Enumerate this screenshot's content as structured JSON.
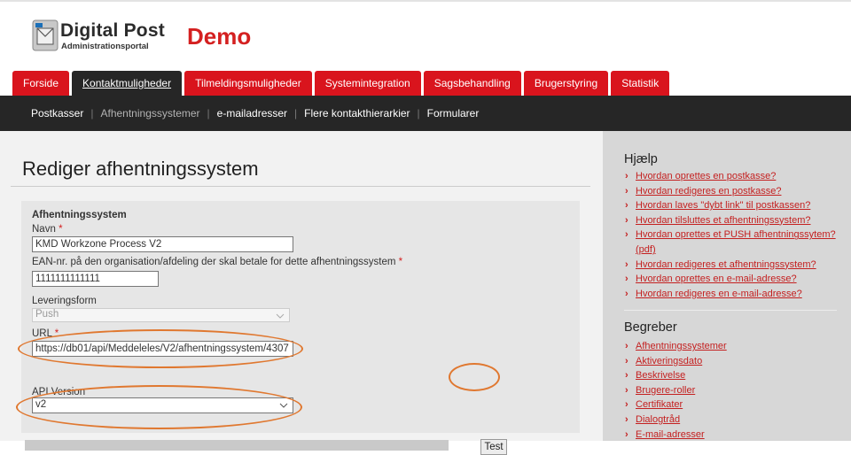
{
  "header": {
    "logo_title": "Digital Post",
    "logo_subtitle": "Administrationsportal",
    "demo_label": "Demo"
  },
  "tabs": [
    {
      "label": "Forside",
      "active": false
    },
    {
      "label": "Kontaktmuligheder",
      "active": true
    },
    {
      "label": "Tilmeldingsmuligheder",
      "active": false
    },
    {
      "label": "Systemintegration",
      "active": false
    },
    {
      "label": "Sagsbehandling",
      "active": false
    },
    {
      "label": "Brugerstyring",
      "active": false
    },
    {
      "label": "Statistik",
      "active": false
    }
  ],
  "subnav": [
    {
      "label": "Postkasser",
      "active": false
    },
    {
      "label": "Afhentningssystemer",
      "active": true
    },
    {
      "label": "e-mailadresser",
      "active": false
    },
    {
      "label": "Flere kontakthierarkier",
      "active": false
    },
    {
      "label": "Formularer",
      "active": false
    }
  ],
  "page": {
    "title": "Rediger afhentningssystem"
  },
  "form": {
    "section_title": "Afhentningssystem",
    "name_label": "Navn",
    "name_value": "KMD Workzone Process V2",
    "ean_label": "EAN-nr. på den organisation/afdeling der skal betale for dette afhentningssystem",
    "ean_value": "1111111111111",
    "delivery_label": "Leveringsform",
    "delivery_value": "Push",
    "url_label": "URL",
    "url_value": "https://db01/api/Meddeleles/V2/afhentningssystem/4307",
    "test_label": "Test",
    "api_label": "API Version",
    "api_value": "v2",
    "required_mark": "*"
  },
  "help": {
    "title": "Hjælp",
    "links": [
      "Hvordan oprettes en postkasse?",
      "Hvordan redigeres en postkasse?",
      "Hvordan laves \"dybt link\" til postkassen?",
      "Hvordan tilsluttes et afhentningssystem?",
      "Hvordan oprettes et PUSH afhentningssytem? (pdf)",
      "Hvordan redigeres et afhentningssystem?",
      "Hvordan oprettes en e-mail-adresse?",
      "Hvordan redigeres en e-mail-adresse?"
    ]
  },
  "concepts": {
    "title": "Begreber",
    "links": [
      "Afhentningssystemer",
      "Aktiveringsdato",
      "Beskrivelse",
      "Brugere-roller",
      "Certifikater",
      "Dialogtråd",
      "E-mail-adresser"
    ]
  },
  "colors": {
    "brand_red": "#d9141d",
    "nav_dark": "#262626",
    "highlight_orange": "#e07830"
  }
}
